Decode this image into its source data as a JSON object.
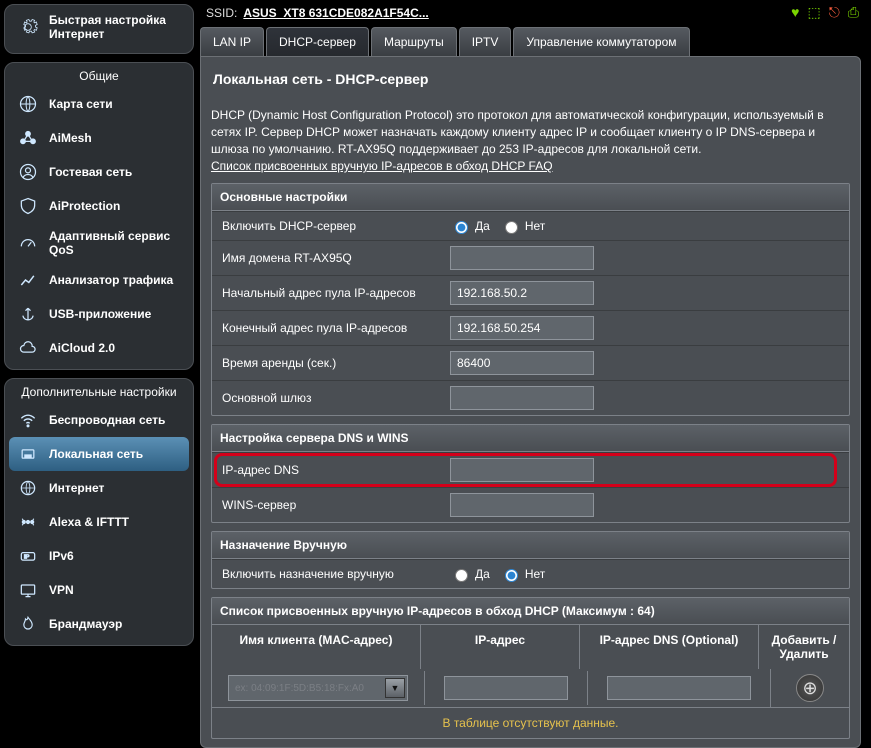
{
  "sidebar": {
    "quick": {
      "l1": "Быстрая настройка",
      "l2": "Интернет"
    },
    "general_title": "Общие",
    "general": [
      {
        "label": "Карта сети"
      },
      {
        "label": "AiMesh"
      },
      {
        "label": "Гостевая сеть"
      },
      {
        "label": "AiProtection"
      },
      {
        "label": "Адаптивный сервис QoS"
      },
      {
        "label": "Анализатор трафика"
      },
      {
        "label": "USB-приложение"
      },
      {
        "label": "AiCloud 2.0"
      }
    ],
    "advanced_title": "Дополнительные настройки",
    "advanced": [
      {
        "label": "Беспроводная сеть"
      },
      {
        "label": "Локальная сеть"
      },
      {
        "label": "Интернет"
      },
      {
        "label": "Alexa & IFTTT"
      },
      {
        "label": "IPv6"
      },
      {
        "label": "VPN"
      },
      {
        "label": "Брандмауэр"
      }
    ]
  },
  "header": {
    "ssid_label": "SSID:",
    "ssid_value": "ASUS_XT8   631CDE082A1F54C..."
  },
  "tabs": [
    "LAN IP",
    "DHCP-сервер",
    "Маршруты",
    "IPTV",
    "Управление коммутатором"
  ],
  "title": "Локальная сеть - DHCP-сервер",
  "desc": {
    "p1": "DHCP (Dynamic Host Configuration Protocol) это протокол для автоматической конфигурации, используемый в сетях IP. Сервер DHCP может назначать каждому клиенту адрес IP и сообщает клиенту о IP DNS-сервера и шлюза по умолчанию. RT-AX95Q поддерживает до 253 IP-адресов для локальной сети.",
    "link": "Список присвоенных вручную IP-адресов в обход DHCP FAQ"
  },
  "basic": {
    "title": "Основные настройки",
    "enable": "Включить DHCP-сервер",
    "yes": "Да",
    "no": "Нет",
    "domain": "Имя домена RT-AX95Q",
    "start": "Начальный адрес пула IP-адресов",
    "start_v": "192.168.50.2",
    "end": "Конечный адрес пула IP-адресов",
    "end_v": "192.168.50.254",
    "lease": "Время аренды (сек.)",
    "lease_v": "86400",
    "gateway": "Основной шлюз"
  },
  "dns": {
    "title": "Настройка сервера DNS и WINS",
    "dns": "IP-адрес DNS",
    "wins": "WINS-сервер"
  },
  "manual": {
    "title": "Назначение Вручную",
    "enable": "Включить назначение вручную",
    "yes": "Да",
    "no": "Нет"
  },
  "list": {
    "title": "Список присвоенных вручную IP-адресов в обход DHCP (Максимум : 64)",
    "col1": "Имя клиента (MAC-адрес)",
    "col2": "IP-адрес",
    "col3": "IP-адрес DNS (Optional)",
    "col4": "Добавить / Удалить",
    "placeholder": "ex: 04:09:1F:5D:B5:18:Fx:A0",
    "empty": "В таблице отсутствуют данные."
  }
}
